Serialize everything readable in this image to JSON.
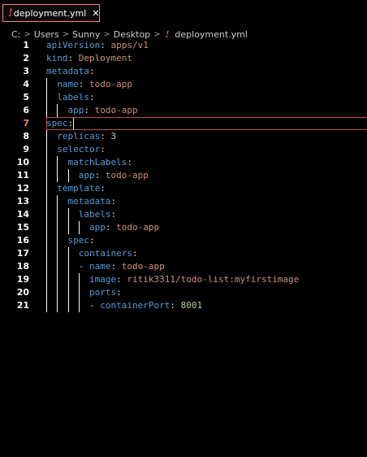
{
  "tab": {
    "warning_glyph": "!",
    "title": "deployment.yml",
    "close": "✕"
  },
  "breadcrumb": {
    "separator": ">",
    "items": [
      "C:",
      "Users",
      "Sunny",
      "Desktop"
    ],
    "file_warning": "!",
    "file": "deployment.yml"
  },
  "editor": {
    "current_line": 7,
    "lines": [
      {
        "num": "1",
        "indent": 0,
        "key": "apiVersion",
        "colon": ": ",
        "value": "apps/v1"
      },
      {
        "num": "2",
        "indent": 0,
        "key": "kind",
        "colon": ": ",
        "value": "Deployment"
      },
      {
        "num": "3",
        "indent": 0,
        "key": "metadata",
        "colon": ":",
        "value": ""
      },
      {
        "num": "4",
        "indent": 1,
        "key": "name",
        "colon": ": ",
        "value": "todo-app"
      },
      {
        "num": "5",
        "indent": 1,
        "key": "labels",
        "colon": ":",
        "value": ""
      },
      {
        "num": "6",
        "indent": 2,
        "key": "app",
        "colon": ": ",
        "value": "todo-app"
      },
      {
        "num": "7",
        "indent": 0,
        "key": "spec",
        "colon": ":",
        "value": ""
      },
      {
        "num": "8",
        "indent": 1,
        "key": "replicas",
        "colon": ": ",
        "value": "3"
      },
      {
        "num": "9",
        "indent": 1,
        "key": "selector",
        "colon": ":",
        "value": ""
      },
      {
        "num": "10",
        "indent": 2,
        "key": "matchLabels",
        "colon": ":",
        "value": ""
      },
      {
        "num": "11",
        "indent": 3,
        "key": "app",
        "colon": ": ",
        "value": "todo-app"
      },
      {
        "num": "12",
        "indent": 1,
        "key": "template",
        "colon": ":",
        "value": ""
      },
      {
        "num": "13",
        "indent": 2,
        "key": "metadata",
        "colon": ":",
        "value": ""
      },
      {
        "num": "14",
        "indent": 3,
        "key": "labels",
        "colon": ":",
        "value": ""
      },
      {
        "num": "15",
        "indent": 4,
        "key": "app",
        "colon": ": ",
        "value": "todo-app"
      },
      {
        "num": "16",
        "indent": 2,
        "key": "spec",
        "colon": ":",
        "value": ""
      },
      {
        "num": "17",
        "indent": 3,
        "key": "containers",
        "colon": ":",
        "value": ""
      },
      {
        "num": "18",
        "indent": 3,
        "dash": "- ",
        "key": "name",
        "colon": ": ",
        "value": "todo-app"
      },
      {
        "num": "19",
        "indent": 4,
        "key": "image",
        "colon": ": ",
        "value": "ritik3311/todo-list:myfirstimage"
      },
      {
        "num": "20",
        "indent": 4,
        "key": "ports",
        "colon": ":",
        "value": ""
      },
      {
        "num": "21",
        "indent": 4,
        "dash": "- ",
        "key": "containerPort",
        "colon": ": ",
        "value": "8001"
      }
    ]
  },
  "colors": {
    "background": "#000000",
    "key": "#569cd6",
    "string": "#ce9178",
    "number": "#b5cea8",
    "punctuation": "#d4d4d4",
    "error": "#f14c4c",
    "current_line_border": "#b3544a"
  }
}
